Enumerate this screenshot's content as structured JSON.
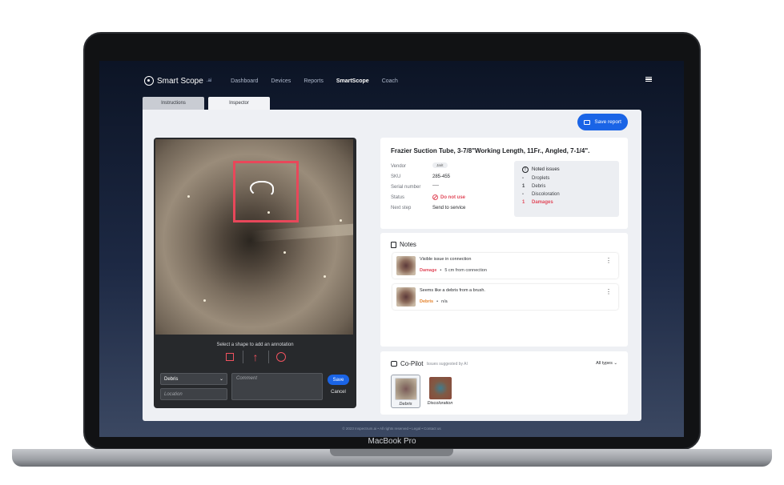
{
  "app": {
    "logo_text": "Smart Scope",
    "logo_suffix": ".ai"
  },
  "nav": {
    "items": [
      "Dashboard",
      "Devices",
      "Reports",
      "SmartScope",
      "Coach"
    ],
    "active": "SmartScope"
  },
  "tabs": [
    "Instructions",
    "Inspector"
  ],
  "actions": {
    "save_report": "Save report"
  },
  "inspector": {
    "hint": "Select a shape to add an annotation",
    "type_value": "Debris",
    "location_placeholder": "Location",
    "comment_placeholder": "Comment",
    "save": "Save",
    "cancel": "Cancel"
  },
  "product": {
    "title": "Frazier Suction Tube, 3-7/8\"Working Length, 11Fr., Angled, 7-1/4\".",
    "fields": [
      {
        "label": "Vendor",
        "value": "Jarit"
      },
      {
        "label": "SKU",
        "value": "285-455"
      },
      {
        "label": "Serial number",
        "value": "----"
      },
      {
        "label": "Status",
        "value": "Do not use"
      },
      {
        "label": "Next step",
        "value": "Send to service"
      }
    ],
    "issues_title": "Noted issues",
    "issues": [
      {
        "count": "-",
        "name": "Droplets"
      },
      {
        "count": "1",
        "name": "Debris"
      },
      {
        "count": "-",
        "name": "Discoloration"
      },
      {
        "count": "1",
        "name": "Damages"
      }
    ]
  },
  "notes": {
    "title": "Notes",
    "items": [
      {
        "text": "Visible issue in connection",
        "tag": "Damage",
        "detail": "5 cm from connection"
      },
      {
        "text": "Seems like a debris from a brush.",
        "tag": "Debris",
        "detail": "n/a"
      }
    ]
  },
  "copilot": {
    "title": "Co-Pilot",
    "subtitle": "Issues suggested by AI",
    "filter": "All types",
    "suggestions": [
      "Debris",
      "Discoloration"
    ]
  },
  "footer": {
    "text": "© 2023 Inspectrum.ai   •   All rights reserved   •   Legal   •   Contact us"
  },
  "device": {
    "brand": "MacBook Pro"
  },
  "colors": {
    "accent": "#1a64e6",
    "danger": "#e14a5b",
    "warning": "#e4822b",
    "annotation": "#e8475a"
  },
  "icons": [
    "hamburger-icon",
    "save-icon",
    "square-shape-icon",
    "arrow-shape-icon",
    "circle-shape-icon",
    "info-icon",
    "notes-icon",
    "robot-icon",
    "kebab-icon",
    "chevron-down-icon",
    "no-entry-icon"
  ]
}
